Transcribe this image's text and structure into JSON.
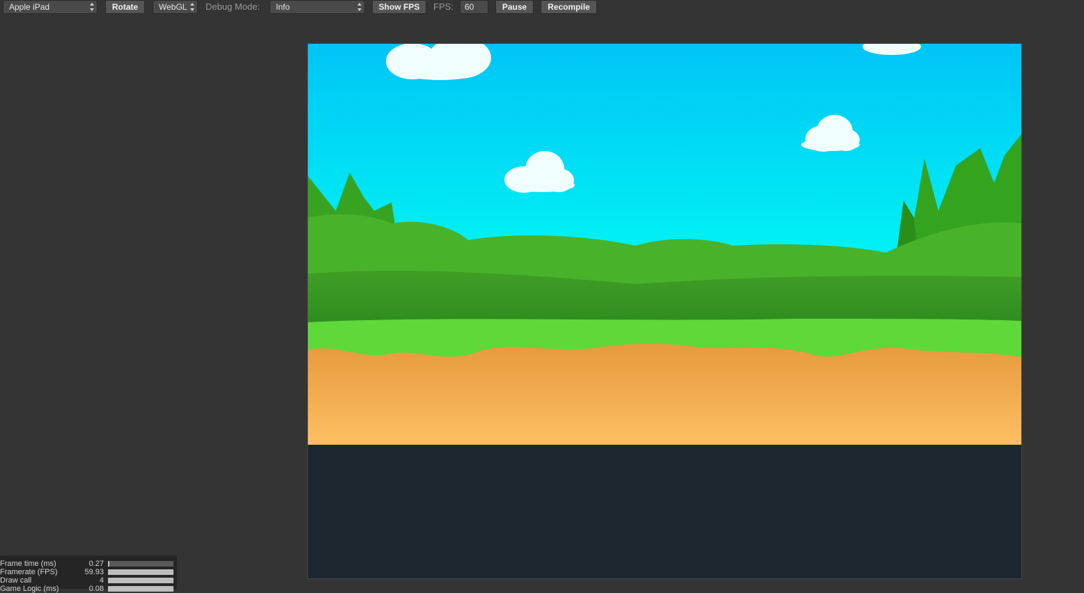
{
  "toolbar": {
    "device_select": "Apple iPad",
    "rotate_label": "Rotate",
    "renderer_select": "WebGL",
    "debug_mode_label": "Debug Mode:",
    "debug_mode_select": "Info",
    "show_fps_label": "Show FPS",
    "fps_label": "FPS:",
    "fps_value": "60",
    "pause_label": "Pause",
    "recompile_label": "Recompile"
  },
  "stats": [
    {
      "name": "Frame time (ms)",
      "value": "0.27",
      "level": 0.02
    },
    {
      "name": "Framerate (FPS)",
      "value": "59.93",
      "level": 1.0
    },
    {
      "name": "Draw call",
      "value": "4",
      "level": 1.0
    },
    {
      "name": "Game Logic (ms)",
      "value": "0.08",
      "level": 1.0
    }
  ],
  "colors": {
    "sky_top": "#00c6f4",
    "sky_mid": "#00f0f4",
    "grass_dark": "#2f8d1f",
    "grass_light": "#6ce040",
    "sand_top": "#e59a3d",
    "sand_bottom": "#fdbf62",
    "cloud": "#f1feff"
  }
}
